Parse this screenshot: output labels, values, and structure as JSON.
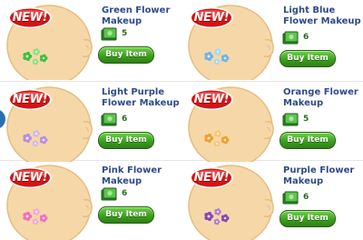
{
  "badge_label": "NEW!",
  "buy_label": "Buy Item",
  "colors": {
    "skin": "#f6d8a8",
    "skin_shade": "#e5bd83",
    "title": "#2f4a8c",
    "buy_button": "#3ea021",
    "badge_red": "#d21414"
  },
  "items": [
    {
      "title": "Green Flower Makeup",
      "price": "5",
      "flower_color": "#3fbf3f",
      "flower_color_2": "#8fe07f"
    },
    {
      "title": "Light Blue Flower Makeup",
      "price": "6",
      "flower_color": "#6fb4e8",
      "flower_color_2": "#a8d8f5"
    },
    {
      "title": "Light Purple Flower Makeup",
      "price": "6",
      "flower_color": "#b690e0",
      "flower_color_2": "#d2b8ef"
    },
    {
      "title": "Orange Flower Makeup",
      "price": "5",
      "flower_color": "#f0a030",
      "flower_color_2": "#f6c878"
    },
    {
      "title": "Pink Flower Makeup",
      "price": "6",
      "flower_color": "#f070c0",
      "flower_color_2": "#f6a8dc"
    },
    {
      "title": "Purple Flower Makeup",
      "price": "6",
      "flower_color": "#8a46b8",
      "flower_color_2": "#b080d8"
    }
  ]
}
